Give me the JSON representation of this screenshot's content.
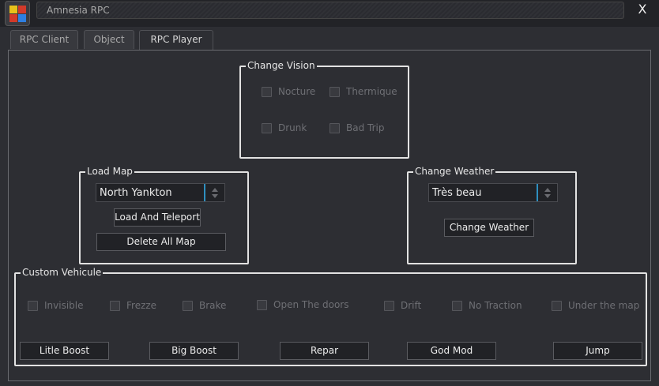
{
  "window": {
    "title": "Amnesia RPC",
    "close_label": "X"
  },
  "tabs": [
    {
      "label": "RPC Client"
    },
    {
      "label": "Object"
    },
    {
      "label": "RPC Player"
    }
  ],
  "change_vision": {
    "title": "Change Vision",
    "options": [
      {
        "label": "Nocture"
      },
      {
        "label": "Thermique"
      },
      {
        "label": "Drunk"
      },
      {
        "label": "Bad Trip"
      }
    ]
  },
  "load_map": {
    "title": "Load Map",
    "selected": "North Yankton",
    "load_button": "Load And Teleport",
    "delete_button": "Delete All Map"
  },
  "change_weather": {
    "title": "Change Weather",
    "selected": "Très beau",
    "button": "Change Weather"
  },
  "custom_vehicle": {
    "title": "Custom Vehicule",
    "options": [
      {
        "label": "Invisible"
      },
      {
        "label": "Frezze"
      },
      {
        "label": "Brake"
      },
      {
        "label": "Open The doors"
      },
      {
        "label": "Drift"
      },
      {
        "label": "No Traction"
      },
      {
        "label": "Under the map"
      }
    ],
    "buttons": [
      {
        "label": "Litle Boost"
      },
      {
        "label": "Big Boost"
      },
      {
        "label": "Repar"
      },
      {
        "label": "God Mod"
      },
      {
        "label": "Jump"
      }
    ]
  },
  "colors": {
    "accent": "#2f8fbf",
    "group_border": "#e2e2e2",
    "background": "#2d2e33"
  },
  "icons": {
    "app": "app-logo-icon",
    "combo": "spinner-arrows-icon"
  }
}
